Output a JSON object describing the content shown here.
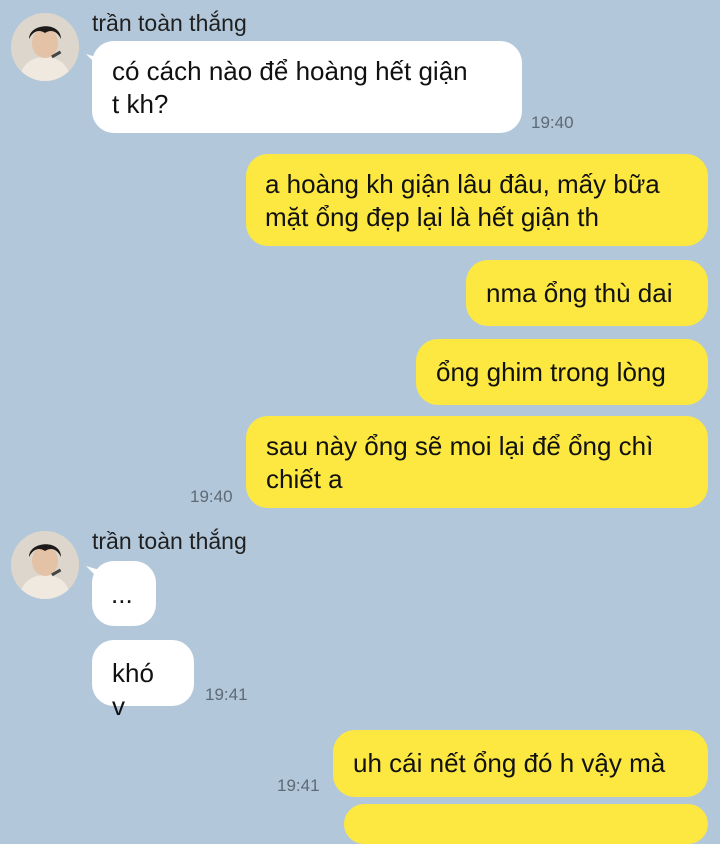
{
  "conversation": {
    "group1": {
      "sender": "trần toàn thắng",
      "msg1": "có cách nào để hoàng hết giận\nt kh?",
      "time": "19:40"
    },
    "outgoing1": {
      "msg1": "a hoàng kh giận lâu đâu, mấy bữa\nmặt ổng đẹp lại là hết giận th",
      "msg2": "nma ổng thù dai",
      "msg3": "ổng ghim trong lòng",
      "msg4": "sau này ổng sẽ moi lại để ổng chì\nchiết a",
      "time": "19:40"
    },
    "group2": {
      "sender": "trần toàn thắng",
      "msg1": "...",
      "msg2": "khó v",
      "time": "19:41"
    },
    "outgoing2": {
      "msg1": "uh cái nết ổng đó h vậy mà",
      "time": "19:41"
    }
  },
  "colors": {
    "background": "#b2c7da",
    "incoming_bubble": "#ffffff",
    "outgoing_bubble": "#fce841"
  }
}
